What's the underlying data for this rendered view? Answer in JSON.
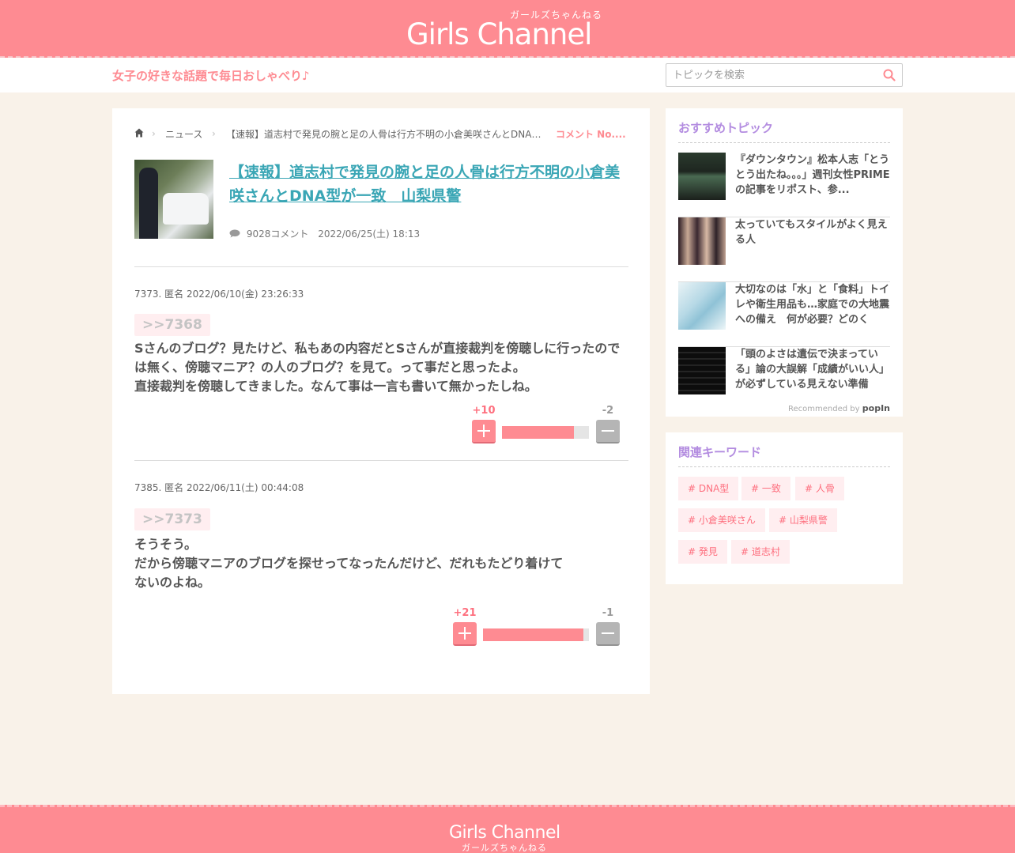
{
  "site": {
    "logo_main": "Girls Channel",
    "logo_kana": "ガールズちゃんねる",
    "tagline": "女子の好きな話題で毎日おしゃべり♪",
    "search_placeholder": "トピックを検索"
  },
  "breadcrumb": {
    "news": "ニュース",
    "topic": "【速報】道志村で発見の腕と足の人骨は行方不明の小倉美咲さんとDNA型...",
    "current": "コメント No...."
  },
  "article": {
    "title": "【速報】道志村で発見の腕と足の人骨は行方不明の小倉美咲さんとDNA型が一致　山梨県警",
    "comment_count": "9028コメント",
    "date": "2022/06/25(土) 18:13"
  },
  "comments": [
    {
      "head": "7373. 匿名 2022/06/10(金) 23:26:33",
      "anchor": ">>7368",
      "lines": [
        "Sさんのブログ？見たけど、私もあの内容だとSさんが直接裁判を傍聴しに行ったので",
        "は無く、傍聴マニア？の人のブログ？を見て。って事だと思ったよ。",
        "直接裁判を傍聴してきました。なんて事は一言も書いて無かったしね。"
      ],
      "plus": "+10",
      "minus": "-2",
      "plus_ratio": 0.83
    },
    {
      "head": "7385. 匿名 2022/06/11(土) 00:44:08",
      "anchor": ">>7373",
      "lines": [
        "そうそう。",
        "だから傍聴マニアのブログを探せってなったんだけど、だれもたどり着けて",
        "ないのよね。"
      ],
      "plus": "+21",
      "minus": "-1",
      "plus_ratio": 0.95
    }
  ],
  "recommended": {
    "heading": "おすすめトピック",
    "items": [
      {
        "text": "『ダウンタウン』松本人志「とうとう出たね。。。」週刊女性PRIMEの記事をリポスト、参..."
      },
      {
        "text": "太っていてもスタイルがよく見える人"
      },
      {
        "text": "大切なのは「水」と「食料」トイレや衛生用品も…家庭での大地震への備え　何が必要？どのくら..."
      },
      {
        "text": "「頭のよさは遺伝で決まっている」論の大誤解「成績がいい人」が必ずしている見えない準備"
      }
    ],
    "recommended_by": "Recommended by",
    "brand": "popIn"
  },
  "keywords": {
    "heading": "関連キーワード",
    "items": [
      "# DNA型",
      "# 一致",
      "# 人骨",
      "# 小倉美咲さん",
      "# 山梨県警",
      "# 発見",
      "# 道志村"
    ]
  },
  "footer": {
    "logo_main": "Girls Channel",
    "logo_kana": "ガールズちゃんねる"
  },
  "colors": {
    "brand_pink": "#fe8b92",
    "link_teal": "#3aa6b5",
    "accent_purple": "#b38ce0",
    "page_background": "#f9f2e9"
  }
}
